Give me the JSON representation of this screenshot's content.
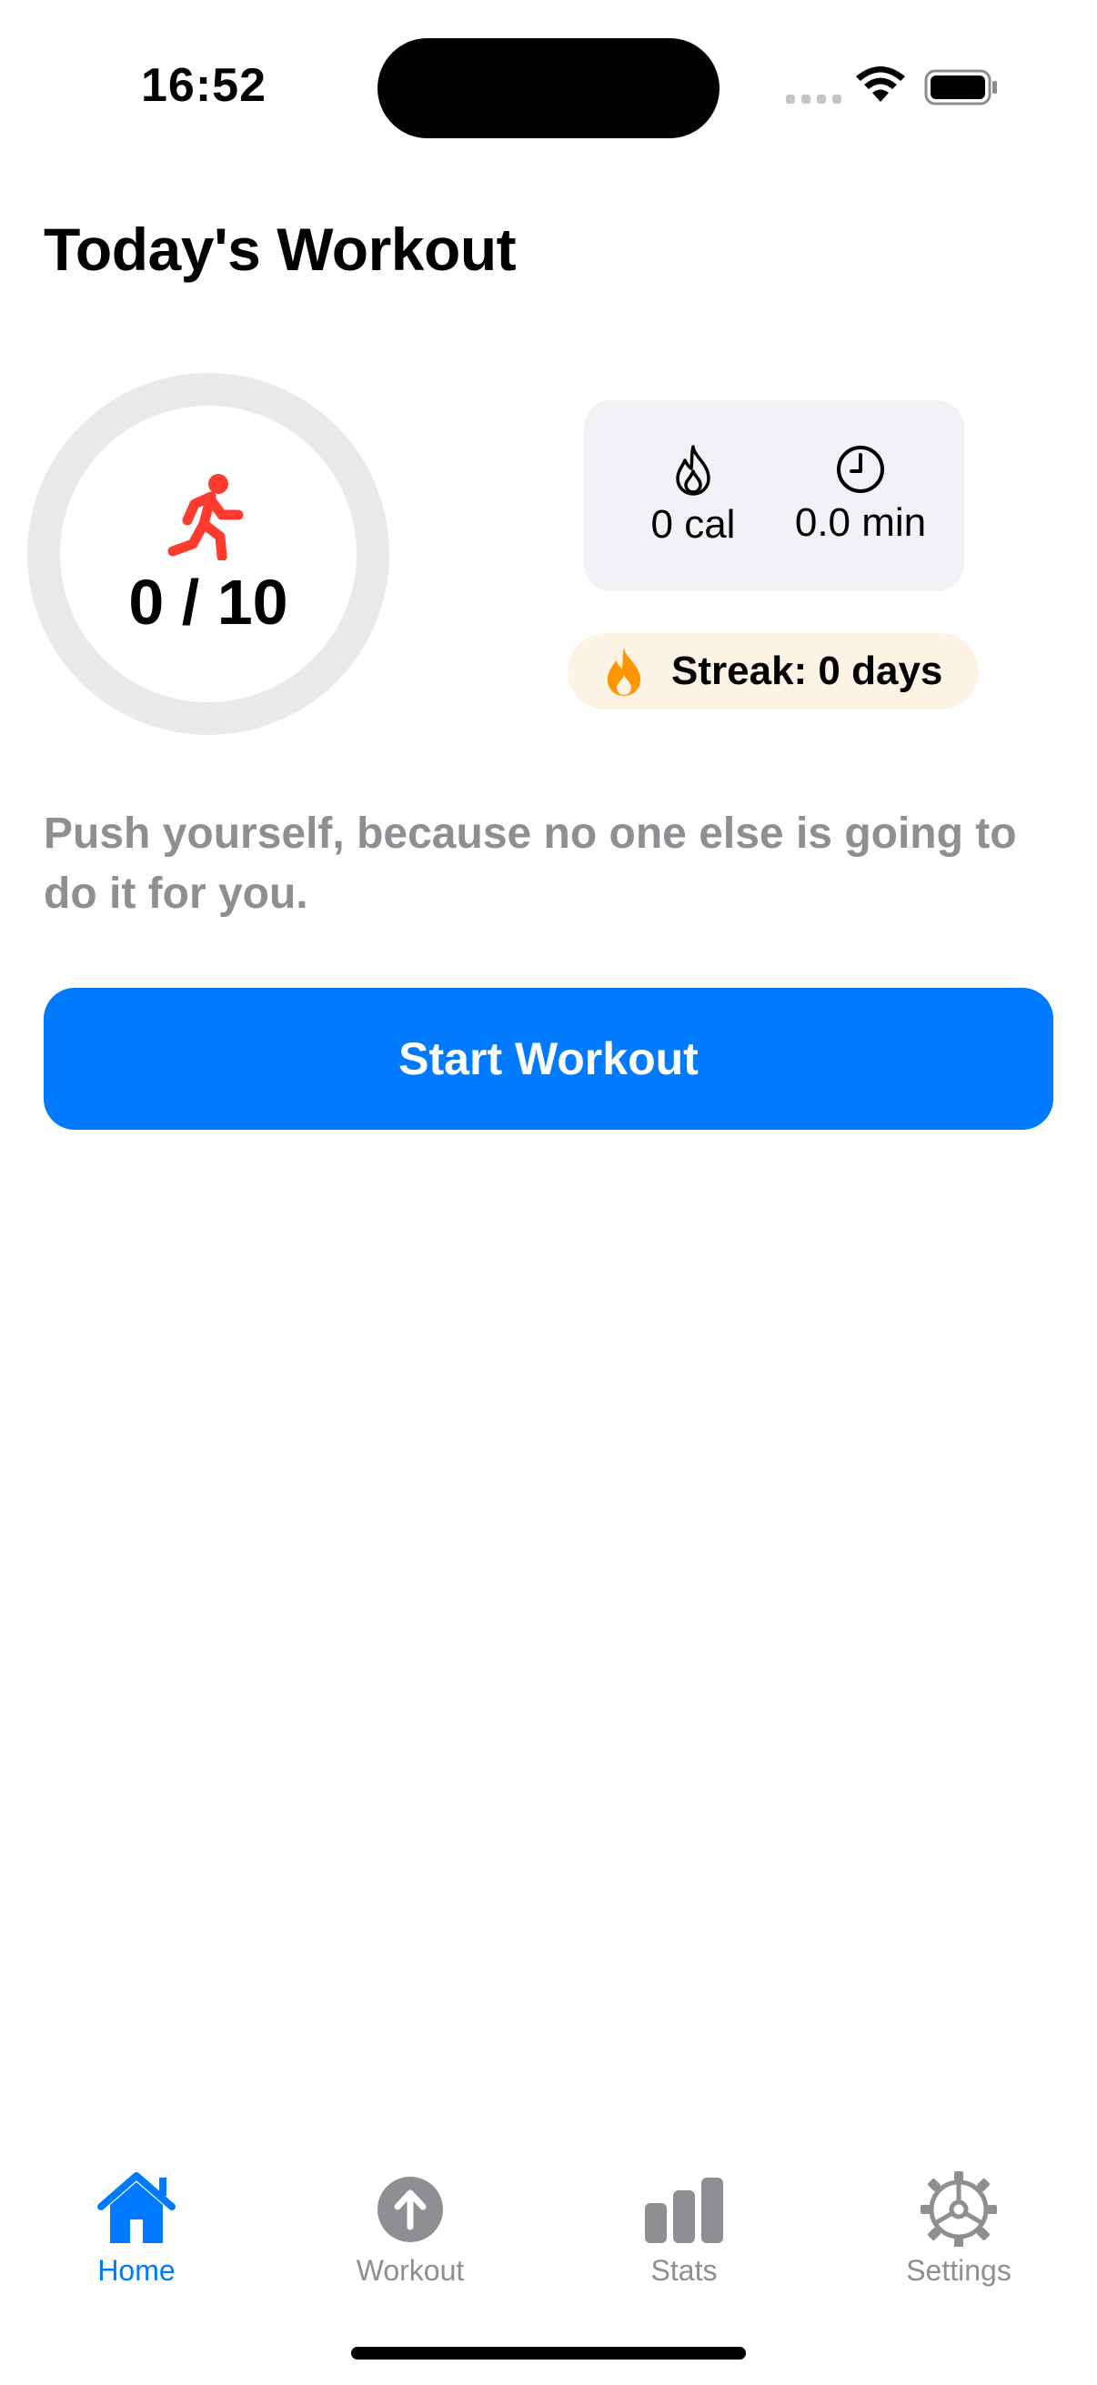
{
  "status_bar": {
    "time": "16:52"
  },
  "page": {
    "title": "Today's Workout"
  },
  "progress": {
    "label": "0 / 10",
    "completed": 0,
    "total": 10,
    "icon": "running-figure-icon",
    "icon_color": "#ff3b30"
  },
  "stats": {
    "calories": {
      "icon": "flame-outline-icon",
      "value": "0 cal"
    },
    "duration": {
      "icon": "clock-icon",
      "value": "0.0 min"
    }
  },
  "streak": {
    "icon": "flame-icon",
    "text": "Streak: 0 days",
    "color": "#ff9500"
  },
  "quote": {
    "text": "Push yourself, because no one else is going to do it for you."
  },
  "actions": {
    "start_workout": "Start Workout"
  },
  "tab_bar": {
    "items": [
      {
        "label": "Home",
        "icon": "house-icon",
        "active": true
      },
      {
        "label": "Workout",
        "icon": "arrow-up-circle-icon",
        "active": false
      },
      {
        "label": "Stats",
        "icon": "bar-chart-icon",
        "active": false
      },
      {
        "label": "Settings",
        "icon": "gear-icon",
        "active": false
      }
    ]
  },
  "colors": {
    "accent": "#007aff",
    "secondary_text": "#8e8e93",
    "ring_track": "#e9e9ea",
    "card_bg": "#f2f2f6",
    "streak_bg": "#fdf3e5"
  }
}
